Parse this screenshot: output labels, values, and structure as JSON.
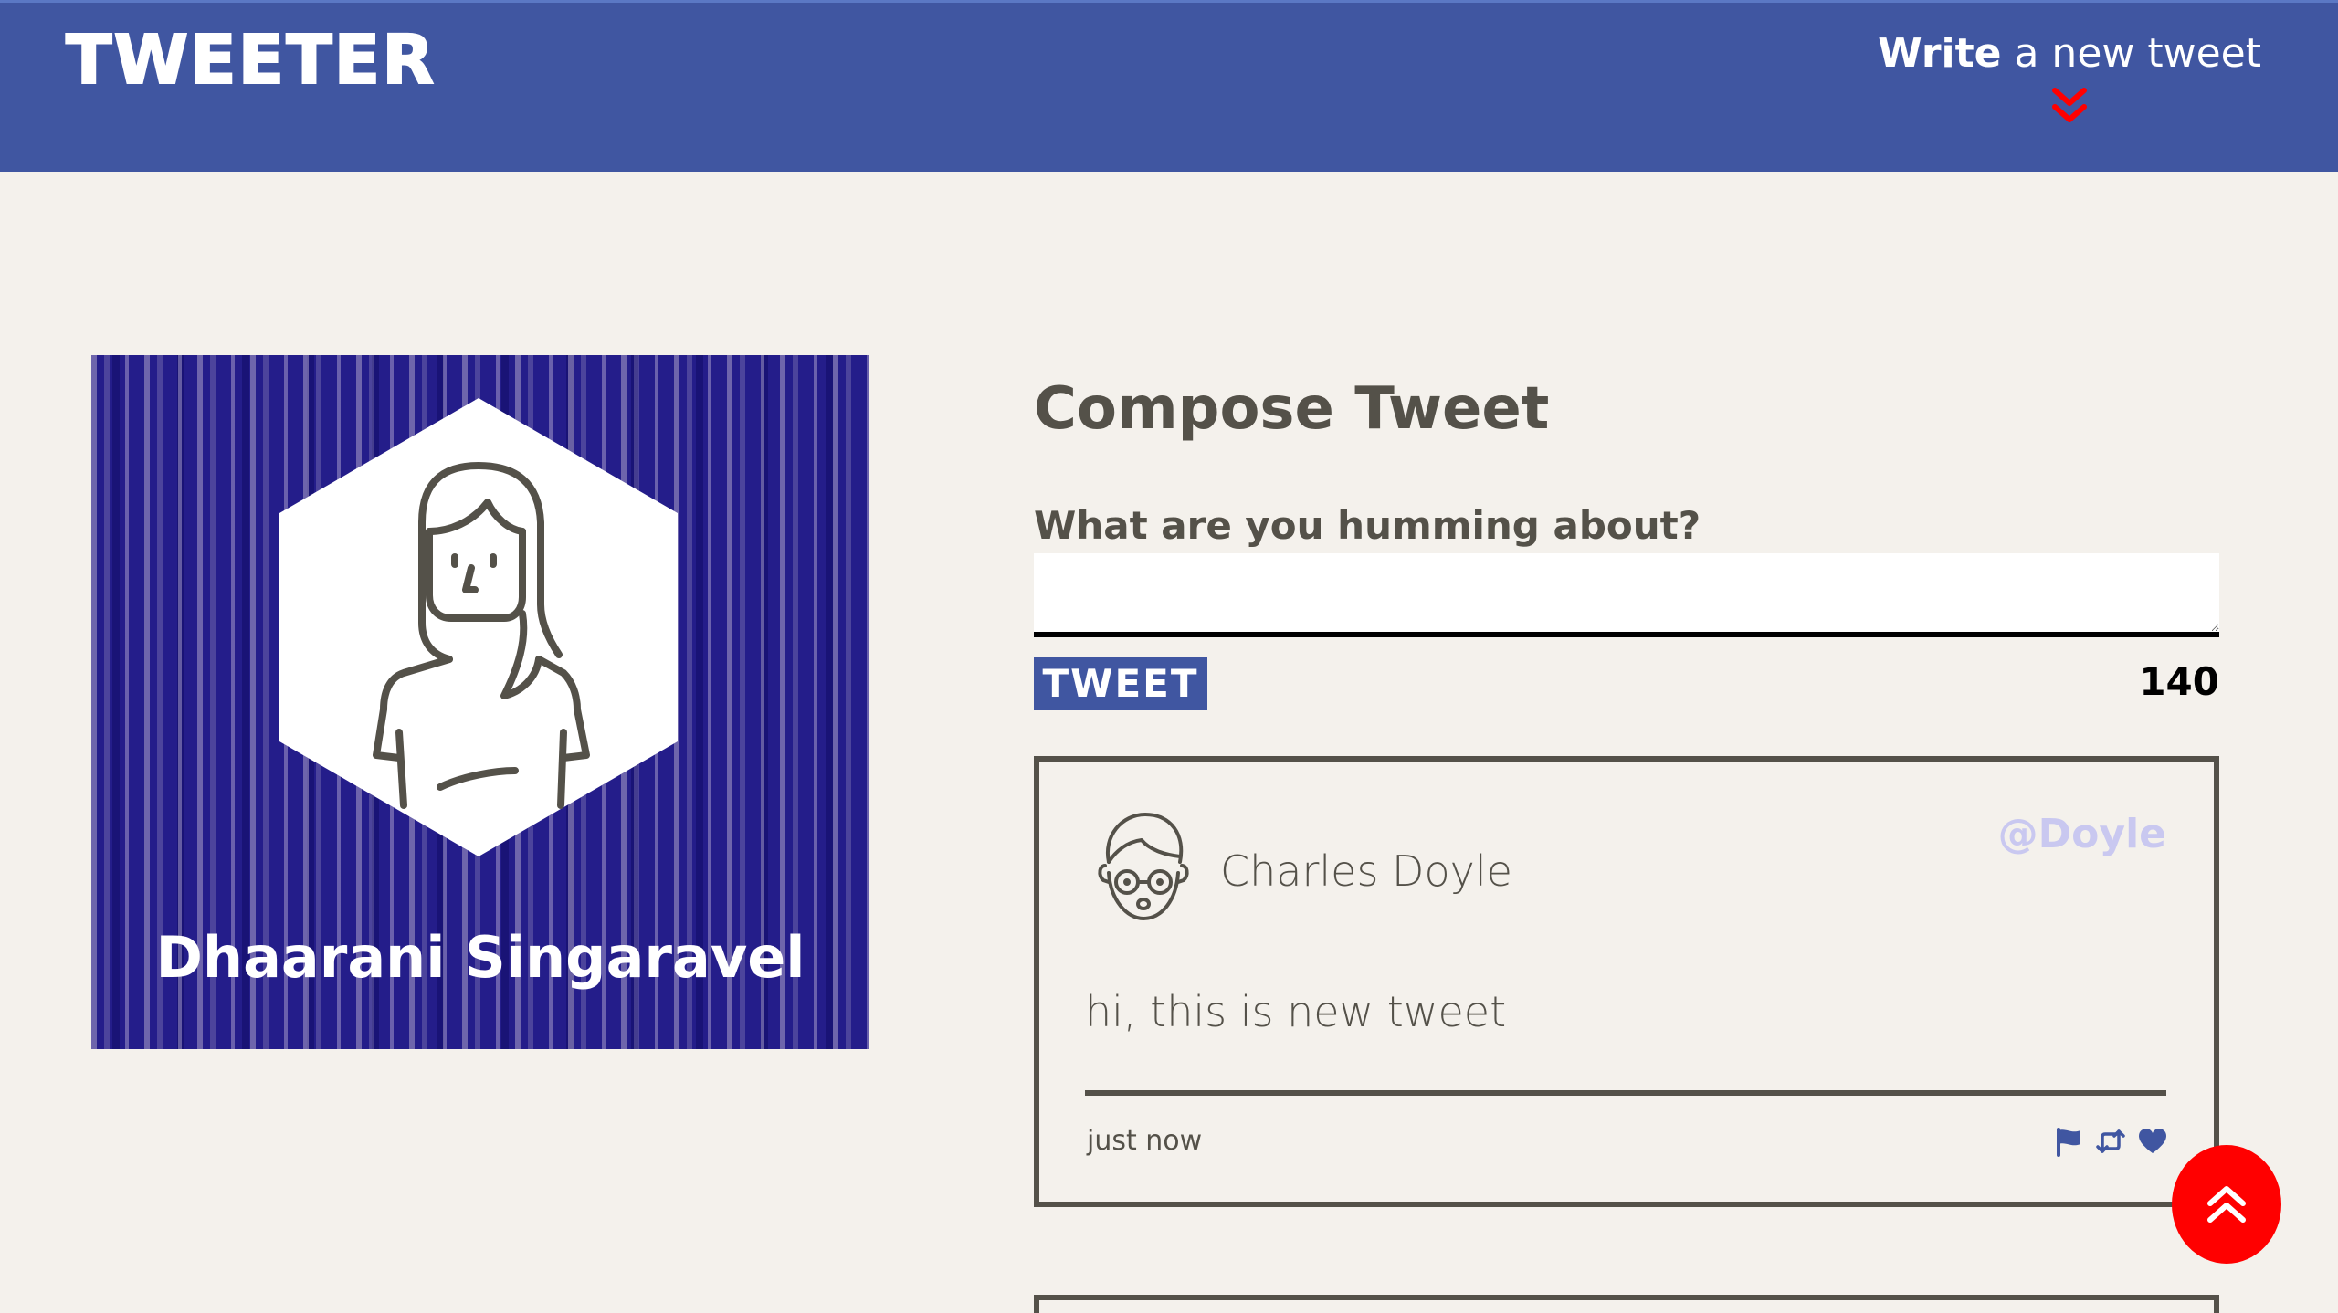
{
  "nav": {
    "brand": "TWEETER",
    "compose_bold": "Write",
    "compose_rest": " a new tweet",
    "compose_icon": "double-chevron-down-icon",
    "accent_color": "#ff0000",
    "bg_color": "#4056a1"
  },
  "profile": {
    "name": "Dhaarani Singaravel",
    "avatar_icon": "woman-avatar-icon",
    "bg_color": "#241d8a"
  },
  "compose": {
    "title": "Compose Tweet",
    "label": "What are you humming about?",
    "input_value": "",
    "button_label": "TWEET",
    "counter": "140"
  },
  "tweets": [
    {
      "name": "Charles Doyle",
      "handle": "@Doyle",
      "avatar_icon": "man-with-glasses-avatar-icon",
      "content": "hi, this is new tweet",
      "timestamp": "just now",
      "actions": [
        "flag-icon",
        "retweet-icon",
        "heart-icon"
      ],
      "handle_color": "#c9c8f0",
      "action_color": "#4056a1"
    }
  ],
  "scroll_top": {
    "icon": "double-chevron-up-icon",
    "color": "#ff0000"
  }
}
